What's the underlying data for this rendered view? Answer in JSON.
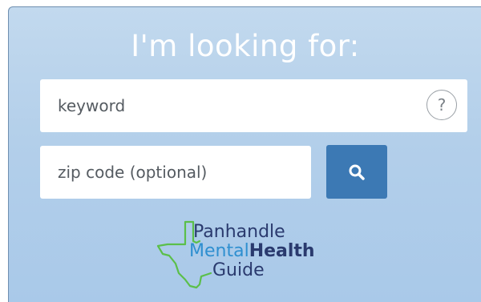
{
  "widget": {
    "heading": "I'm looking for:",
    "keyword_field": {
      "placeholder": "keyword"
    },
    "help_button": {
      "label": "?"
    },
    "zip_field": {
      "placeholder": "zip code (optional)"
    },
    "search_button": {
      "icon": "search-icon"
    }
  },
  "logo": {
    "line1": "Panhandle",
    "line2_part1": "Mental",
    "line2_part2": "Health",
    "line3": "Guide",
    "colors": {
      "navy": "#2a3a6e",
      "blue": "#2e8fd0",
      "green": "#5bbf4a"
    }
  },
  "colors": {
    "panel_top": "#c2d9ee",
    "panel_bottom": "#a9c9e9",
    "search_button": "#3c79b4"
  }
}
